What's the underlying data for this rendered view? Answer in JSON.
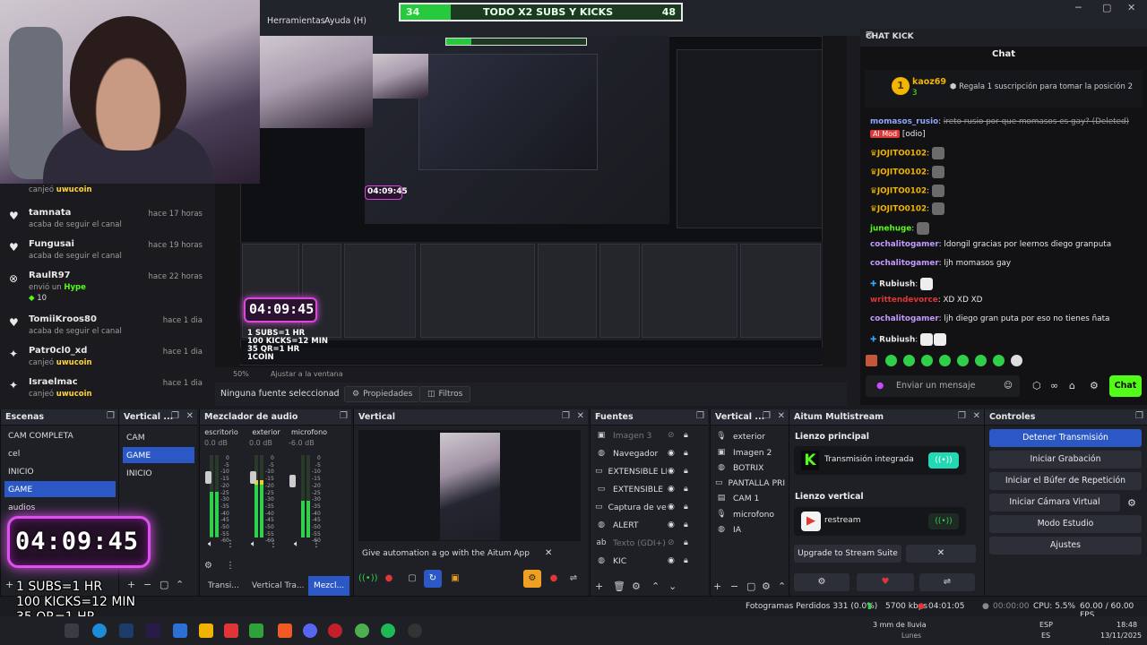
{
  "menu": {
    "tools": "Herramientas",
    "help": "Ayuda (H)"
  },
  "goal_bar": {
    "current": "34",
    "label": "TODO X2 SUBS Y KICKS",
    "target": "48",
    "progress": 0.18
  },
  "feed": [
    {
      "name": "",
      "action": "canjeó",
      "reward": "uwucoin",
      "time": "",
      "icon": "gift-icon"
    },
    {
      "name": "tamnata",
      "action": "acaba de seguir el canal",
      "reward": "",
      "time": "hace 17 horas",
      "icon": "heart-icon"
    },
    {
      "name": "Fungusai",
      "action": "acaba de seguir el canal",
      "reward": "",
      "time": "hace 19 horas",
      "icon": "heart-icon"
    },
    {
      "name": "RaulR97",
      "action": "envió un",
      "reward": "Hype",
      "time": "hace 22 horas",
      "icon": "kick-icon",
      "extra": "10"
    },
    {
      "name": "TomiiKroos80",
      "action": "acaba de seguir el canal",
      "reward": "",
      "time": "hace 1 dia",
      "icon": "heart-icon"
    },
    {
      "name": "Patr0cl0_xd",
      "action": "canjeó",
      "reward": "uwucoin",
      "time": "hace 1 dia",
      "icon": "gift-icon"
    },
    {
      "name": "Israelmac",
      "action": "canjeó",
      "reward": "uwucoin",
      "time": "hace 1 dia",
      "icon": "gift-icon"
    }
  ],
  "preview": {
    "zoom": "50%",
    "fit": "Ajustar a la ventana",
    "timer": "04:09:45",
    "mini_timer": "04:09:45",
    "overlay_lines": [
      "1 SUBS=1 HR",
      "100 KICKS=12 MIN",
      "35 QR=1 HR",
      "1COIN"
    ]
  },
  "source_bar": {
    "no_source": "Ninguna fuente seleccionad",
    "properties": "Propiedades",
    "filters": "Filtros"
  },
  "chat": {
    "window_title": "CHAT KICK",
    "title": "Chat",
    "top_user": "kaoz69",
    "top_rank": "1",
    "top_count": "3",
    "top_prompt": "Regala 1 suscripción para tomar la posición 2",
    "messages": [
      {
        "user": "momasos_rusio",
        "text": "ireto rusio por que momasos es gay? (Deleted)",
        "badge": "Al Mod",
        "tag": "[odio]"
      },
      {
        "user": "JOJITO0102",
        "text": ""
      },
      {
        "user": "JOJITO0102",
        "text": ""
      },
      {
        "user": "JOJITO0102",
        "text": ""
      },
      {
        "user": "JOJITO0102",
        "text": ""
      },
      {
        "user": "junehuge",
        "text": ""
      },
      {
        "user": "cochalitogamer",
        "text": "ldongil gracias por leernos diego granputa"
      },
      {
        "user": "cochalitogamer",
        "text": "ljh momasos gay"
      },
      {
        "user": "Rubiush",
        "text": ""
      },
      {
        "user": "writtendevorce",
        "text": "XD XD XD"
      },
      {
        "user": "cochalitogamer",
        "text": "ljh diego gran puta por eso no tienes ñata"
      },
      {
        "user": "Rubiush",
        "text": ""
      }
    ],
    "input_placeholder": "Enviar un mensaje",
    "send_label": "Chat"
  },
  "docks": {
    "scenes": {
      "title": "Escenas",
      "items": [
        "CAM COMPLETA",
        "cel",
        "INICIO",
        "GAME",
        "audios"
      ],
      "selected": 3
    },
    "vertical_scenes": {
      "title": "Vertical ...",
      "items": [
        "CAM",
        "GAME",
        "INICIO"
      ],
      "selected": 1
    },
    "mixer": {
      "title": "Mezclador de audio",
      "channels": [
        {
          "name": "escritorio",
          "db": "0.0 dB",
          "level": 0.55
        },
        {
          "name": "exterior",
          "db": "0.0 dB",
          "level": 0.7
        },
        {
          "name": "microfono",
          "db": "-6.0 dB",
          "level": 0.45
        }
      ],
      "scale": [
        "0",
        "-5",
        "-10",
        "-15",
        "-20",
        "-25",
        "-30",
        "-35",
        "-40",
        "-45",
        "-50",
        "-55",
        "-60"
      ]
    },
    "vertical": {
      "title": "Vertical",
      "notice": "Give automation a go with the Aitum App"
    },
    "sources": {
      "title": "Fuentes",
      "items": [
        {
          "name": "Imagen 3",
          "icon": "image-icon",
          "hidden": true
        },
        {
          "name": "Navegador",
          "icon": "globe-icon",
          "hidden": false
        },
        {
          "name": "EXTENSIBLE LE",
          "icon": "window-icon",
          "hidden": false
        },
        {
          "name": "EXTENSIBLE",
          "icon": "window-icon",
          "hidden": false
        },
        {
          "name": "Captura de ven",
          "icon": "window-icon",
          "hidden": false
        },
        {
          "name": "ALERT",
          "icon": "globe-icon",
          "hidden": false
        },
        {
          "name": "Texto (GDI+)",
          "icon": "text-icon",
          "hidden": true
        },
        {
          "name": "KIC",
          "icon": "globe-icon",
          "hidden": false
        }
      ]
    },
    "vertical_sources": {
      "title": "Vertical ...",
      "items": [
        {
          "name": "exterior",
          "icon": "mic-icon"
        },
        {
          "name": "Imagen 2",
          "icon": "image-icon"
        },
        {
          "name": "BOTRIX",
          "icon": "globe-icon"
        },
        {
          "name": "PANTALLA PRIN",
          "icon": "monitor-icon"
        },
        {
          "name": "CAM 1",
          "icon": "camera-icon"
        },
        {
          "name": "microfono",
          "icon": "mic-icon"
        },
        {
          "name": "IA",
          "icon": "globe-icon"
        }
      ]
    },
    "aitum": {
      "title": "Aitum Multistream",
      "main_canvas": "Lienzo principal",
      "main_output": "Transmisión integrada",
      "vertical_canvas": "Lienzo vertical",
      "vertical_output": "restream",
      "upgrade": "Upgrade to Stream Suite"
    },
    "controls": {
      "title": "Controles",
      "buttons": [
        "Detener Transmisión",
        "Iniciar Grabación",
        "Iniciar el Búfer de Repetición",
        "Iniciar Cámara Virtual",
        "Modo Estudio",
        "Ajustes"
      ]
    }
  },
  "bottom_tabs": [
    "Transi...",
    "Vertical Tra...",
    "Mezcl..."
  ],
  "status": {
    "dropped": "Fotogramas Perdidos 331 (0.0%)",
    "bitrate": "5700 kbps",
    "live_time": "04:01:05",
    "rec_time": "00:00:00",
    "cpu": "CPU: 5.5%",
    "fps": "60.00 / 60.00 FPS"
  },
  "taskbar": {
    "weather": "3 mm de lluvia",
    "weather_sub": "Lunes",
    "lang": "ESP",
    "lang_sub": "ES",
    "time": "18:48",
    "date": "13/11/2025"
  },
  "colors": {
    "accent": "#2b58c5",
    "kick_green": "#53fc18",
    "timer_glow": "#e04ff0",
    "goal_green": "#27c93f"
  }
}
